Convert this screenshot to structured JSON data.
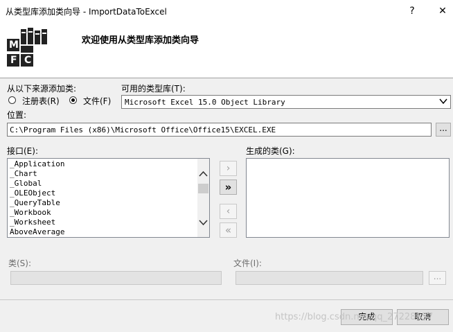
{
  "window": {
    "title": "从类型库添加类向导 - ImportDataToExcel",
    "help_label": "?",
    "close_label": "✕"
  },
  "header": {
    "welcome_text": "欢迎使用从类型库添加类向导"
  },
  "source": {
    "group_label": "从以下来源添加类:",
    "registry_label": "注册表(R)",
    "file_label": "文件(F)",
    "selected": "file"
  },
  "type_library": {
    "label": "可用的类型库(T):",
    "value": "Microsoft Excel 15.0 Object Library"
  },
  "location": {
    "label": "位置:",
    "value": "C:\\Program Files (x86)\\Microsoft Office\\Office15\\EXCEL.EXE",
    "browse_label": "..."
  },
  "interfaces": {
    "label": "接口(E):",
    "items": [
      "_Application",
      "_Chart",
      "_Global",
      "_OLEObject",
      "_QueryTable",
      "_Workbook",
      "_Worksheet",
      "AboveAverage"
    ]
  },
  "transfer_buttons": {
    "add_one": "›",
    "add_all": "»",
    "remove_one": "‹",
    "remove_all": "«"
  },
  "generated_classes": {
    "label": "生成的类(G):",
    "items": []
  },
  "class_field": {
    "label": "类(S):",
    "value": ""
  },
  "file_field": {
    "label": "文件(I):",
    "value": "",
    "browse_label": "..."
  },
  "footer": {
    "finish_label": "完成",
    "cancel_label": "取消",
    "watermark": "https://blog.csdn.net/qq_27228657"
  },
  "logo": {
    "letters": [
      "M",
      "F",
      "C"
    ]
  }
}
